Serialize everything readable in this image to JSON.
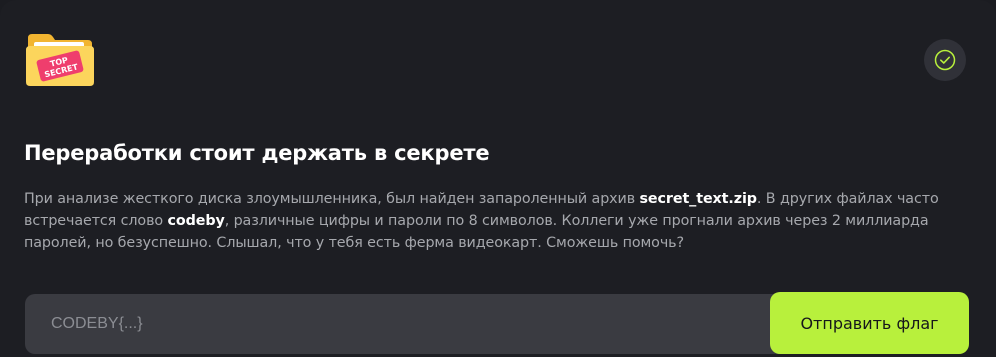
{
  "task": {
    "badge_icon": "top-secret-folder-icon",
    "badge_text_line1": "TOP",
    "badge_text_line2": "SECRET",
    "solved_icon": "check-circle-icon",
    "title": "Переработки стоит держать в секрете",
    "description": {
      "p1": "При анализе жесткого диска злоумышленника, был найден запароленный архив ",
      "archive": "secret_text.zip",
      "p2": ". В других файлах часто встречается слово ",
      "word": "codeby",
      "p3": ", различные цифры и пароли по 8 символов. Коллеги уже прогнали архив через 2 миллиарда паролей, но безуспешно. Слышал, что у тебя есть ферма видеокарт. Сможешь помочь?"
    }
  },
  "flag_form": {
    "value": "",
    "placeholder": "CODEBY{...}",
    "submit_label": "Отправить флаг"
  },
  "colors": {
    "background": "#1d1e23",
    "accent": "#b8f03c",
    "input_bg": "#3a3b41",
    "text_muted": "#a6a8ad"
  }
}
